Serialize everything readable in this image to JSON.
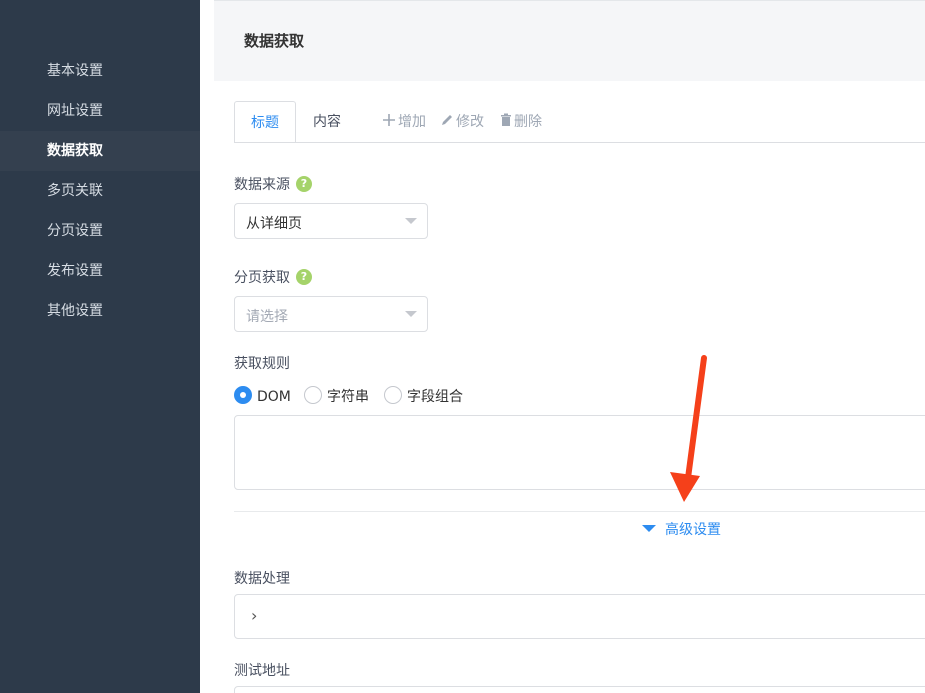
{
  "sidebar": {
    "items": [
      {
        "label": "基本设置"
      },
      {
        "label": "网址设置"
      },
      {
        "label": "数据获取"
      },
      {
        "label": "多页关联"
      },
      {
        "label": "分页设置"
      },
      {
        "label": "发布设置"
      },
      {
        "label": "其他设置"
      }
    ],
    "active_index": 2
  },
  "header": {
    "title": "数据获取"
  },
  "tabs": [
    {
      "label": "标题",
      "active": true
    },
    {
      "label": "内容",
      "active": false
    }
  ],
  "toolbar": {
    "add": {
      "icon": "plus-icon",
      "label": "增加"
    },
    "edit": {
      "icon": "pencil-icon",
      "label": "修改"
    },
    "delete": {
      "icon": "trash-icon",
      "label": "删除"
    }
  },
  "form": {
    "data_source": {
      "label": "数据来源",
      "help": "?",
      "value": "从详细页"
    },
    "pagination": {
      "label": "分页获取",
      "help": "?",
      "placeholder": "请选择"
    },
    "rule": {
      "label": "获取规则",
      "options": [
        {
          "label": "DOM",
          "checked": true
        },
        {
          "label": "字符串",
          "checked": false
        },
        {
          "label": "字段组合",
          "checked": false
        }
      ]
    },
    "advanced": {
      "label": "高级设置"
    },
    "processing": {
      "label": "数据处理",
      "chevron": "›"
    },
    "test_url": {
      "label": "测试地址"
    }
  },
  "colors": {
    "sidebar_bg": "#2d3a4a",
    "accent": "#2d8cf0",
    "help_badge": "#a5d36a",
    "annotation_arrow": "#f5401a"
  }
}
